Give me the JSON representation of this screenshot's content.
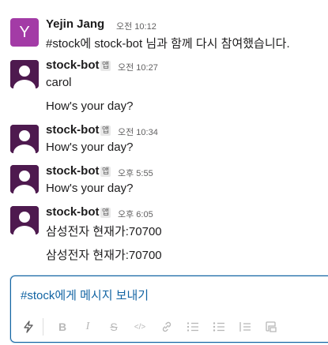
{
  "messages": [
    {
      "author": "Yejin Jang",
      "avatar_initial": "Y",
      "time": "오전 10:12",
      "lines": [
        "#stock에 stock-bot 님과 함께 다시 참여했습니다."
      ]
    },
    {
      "author": "stock-bot",
      "badge": "앱",
      "time": "오전 10:27",
      "lines": [
        "carol",
        "How's your day?"
      ]
    },
    {
      "author": "stock-bot",
      "badge": "앱",
      "time": "오전 10:34",
      "lines": [
        "How's your day?"
      ]
    },
    {
      "author": "stock-bot",
      "badge": "앱",
      "time": "오후 5:55",
      "lines": [
        "How's your day?"
      ]
    },
    {
      "author": "stock-bot",
      "badge": "앱",
      "time": "오후 6:05",
      "lines": [
        "삼성전자 현재가:70700",
        "삼성전자 현재가:70700"
      ]
    }
  ],
  "composer": {
    "placeholder": "#stock에게 메시지 보내기",
    "toolbar": {
      "shortcuts_icon": "lightning-icon",
      "bold": "B",
      "italic": "I",
      "strike": "S",
      "code": "</>",
      "link_icon": "link-icon",
      "ordered_list_icon": "ordered-list-icon",
      "bulleted_list_icon": "bulleted-list-icon",
      "blockquote_icon": "blockquote-icon",
      "code_block_icon": "code-block-icon"
    }
  },
  "colors": {
    "accent": "#1264a3",
    "bot_avatar": "#4e1a4f",
    "user_avatar": "#a33ba6"
  }
}
